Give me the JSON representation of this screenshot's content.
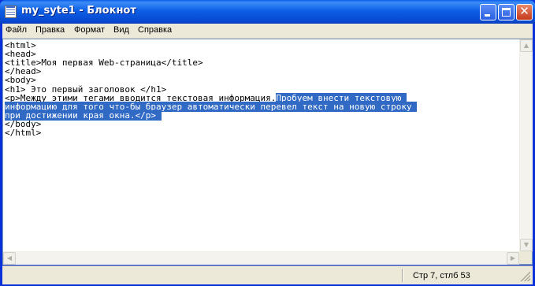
{
  "window": {
    "title": "my_syte1 - Блокнот"
  },
  "menu": [
    "Файл",
    "Правка",
    "Формат",
    "Вид",
    "Справка"
  ],
  "editor": {
    "lines": [
      {
        "pre": "<html>"
      },
      {
        "pre": "<head>"
      },
      {
        "pre": "<title>Моя первая Web-страница</title>"
      },
      {
        "pre": "</head>"
      },
      {
        "pre": "<body>"
      },
      {
        "pre": "<h1> Это первый заголовок </h1>"
      },
      {
        "pre": "<p>Между этими тегами вводится текстовая информация.",
        "sel": "Пробуем внести текстовую "
      },
      {
        "sel": "информацию для того что-бы браузер автоматически перевел текст на новую строку "
      },
      {
        "sel": "при достижении края окна.</p> "
      },
      {
        "pre": "</body>"
      },
      {
        "pre": "</html>"
      }
    ]
  },
  "statusbar": {
    "position": "Стр 7, стлб 53"
  },
  "icons": {
    "app": "notepad-icon",
    "minimize": "minimize-icon",
    "maximize": "maximize-icon",
    "close": "close-icon"
  },
  "colors": {
    "selection": "#316ac5",
    "titlebar": "#0a5de8",
    "chrome": "#ece9d8"
  }
}
